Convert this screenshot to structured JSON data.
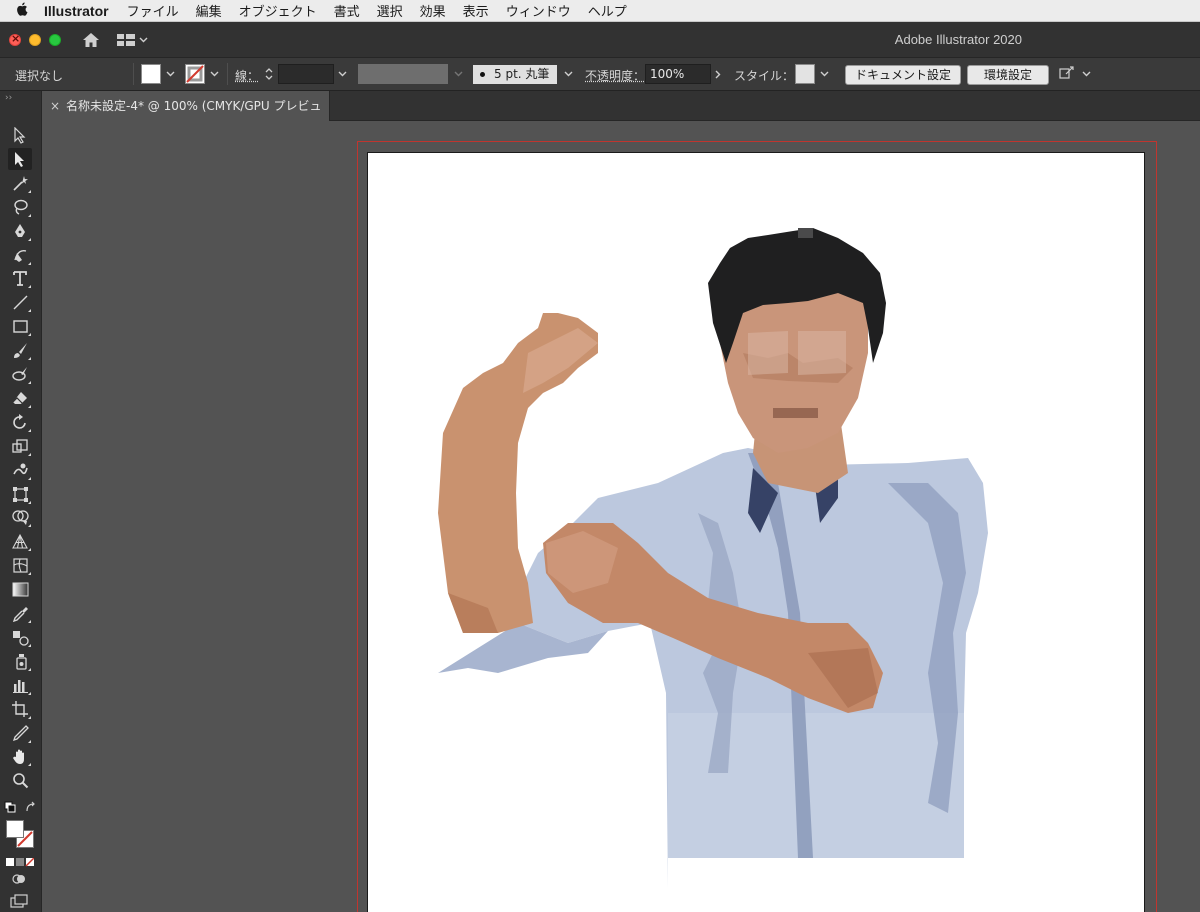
{
  "menubar": {
    "app_name": "Illustrator",
    "menus": [
      "ファイル",
      "編集",
      "オブジェクト",
      "書式",
      "選択",
      "効果",
      "表示",
      "ウィンドウ",
      "ヘルプ"
    ]
  },
  "window": {
    "title": "Adobe Illustrator 2020"
  },
  "control_bar": {
    "selection_label": "選択なし",
    "stroke_label": "線：",
    "brush_label": "5 pt. 丸筆",
    "opacity_label": "不透明度：",
    "opacity_value": "100%",
    "style_label": "スタイル：",
    "document_settings_button": "ドキュメント設定",
    "preferences_button": "環境設定",
    "fill_color": "#ffffff",
    "stroke_color": "none"
  },
  "tab": {
    "label": "名称未設定-4* @ 100% (CMYK/GPU プレビュー)"
  },
  "tools": [
    {
      "name": "selection-tool-icon"
    },
    {
      "name": "direct-selection-tool-icon"
    },
    {
      "name": "magic-wand-tool-icon"
    },
    {
      "name": "lasso-tool-icon"
    },
    {
      "name": "pen-tool-icon"
    },
    {
      "name": "curvature-tool-icon"
    },
    {
      "name": "type-tool-icon"
    },
    {
      "name": "line-tool-icon"
    },
    {
      "name": "rectangle-tool-icon"
    },
    {
      "name": "paintbrush-tool-icon"
    },
    {
      "name": "blob-brush-tool-icon"
    },
    {
      "name": "eraser-tool-icon"
    },
    {
      "name": "rotate-tool-icon"
    },
    {
      "name": "scale-tool-icon"
    },
    {
      "name": "warp-tool-icon"
    },
    {
      "name": "free-transform-tool-icon"
    },
    {
      "name": "shape-builder-tool-icon"
    },
    {
      "name": "perspective-grid-tool-icon"
    },
    {
      "name": "mesh-tool-icon"
    },
    {
      "name": "gradient-tool-icon"
    },
    {
      "name": "eyedropper-tool-icon"
    },
    {
      "name": "blend-tool-icon"
    },
    {
      "name": "symbol-sprayer-tool-icon"
    },
    {
      "name": "column-graph-tool-icon"
    },
    {
      "name": "artboard-tool-icon"
    },
    {
      "name": "slice-tool-icon"
    },
    {
      "name": "hand-tool-icon"
    },
    {
      "name": "zoom-tool-icon"
    }
  ],
  "accent": "#c0352f"
}
